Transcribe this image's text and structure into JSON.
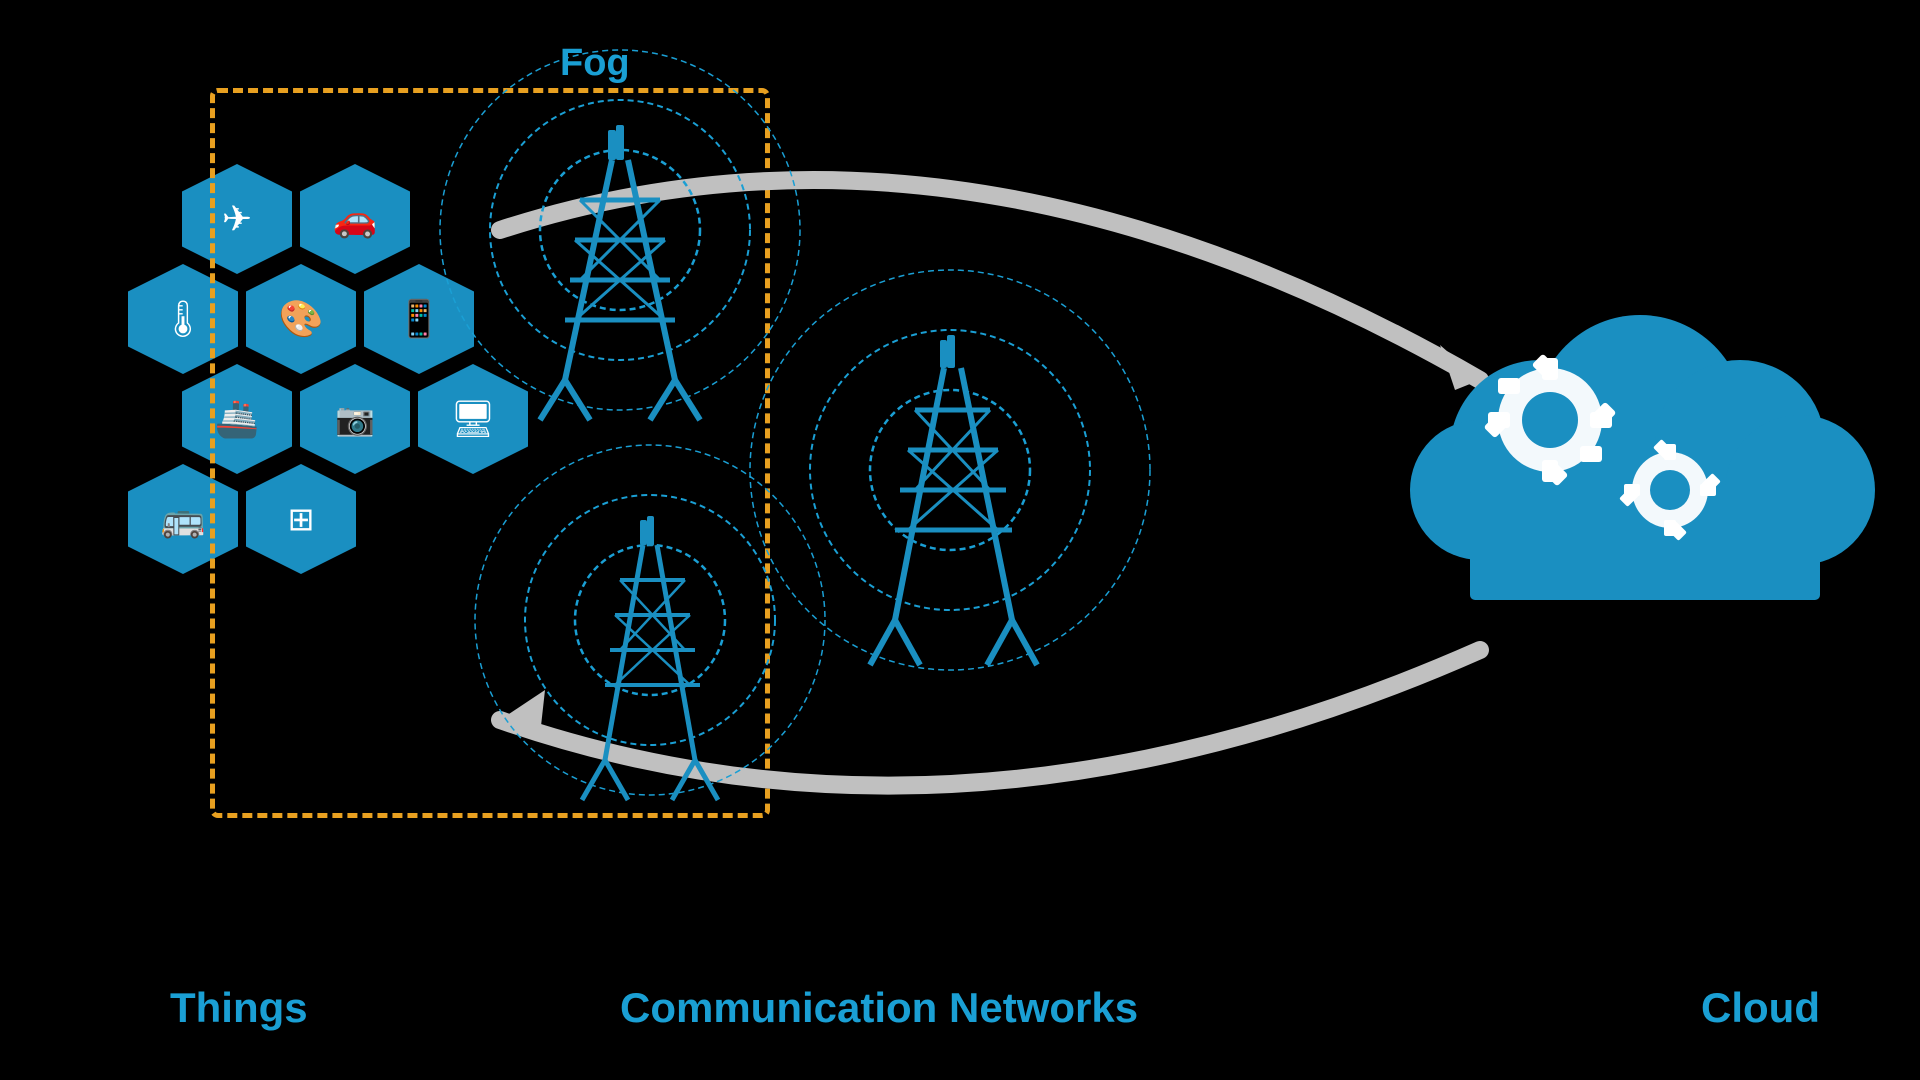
{
  "labels": {
    "fog": "Fog",
    "things": "Things",
    "communication_networks": "Communication Networks",
    "cloud": "Cloud"
  },
  "icons": {
    "airplane": "✈",
    "car": "🚗",
    "thermometer": "🌡",
    "palette": "🎨",
    "phone": "📱",
    "ship": "🚢",
    "camera": "📷",
    "monitor": "🖥",
    "bus": "🚌",
    "grid": "⊞"
  },
  "colors": {
    "blue": "#1a8fc1",
    "accent_blue": "#1a9fd4",
    "orange_dashed": "#e8a020",
    "background": "#000000",
    "arrow_gray": "#b0b0b0",
    "white": "#ffffff"
  }
}
